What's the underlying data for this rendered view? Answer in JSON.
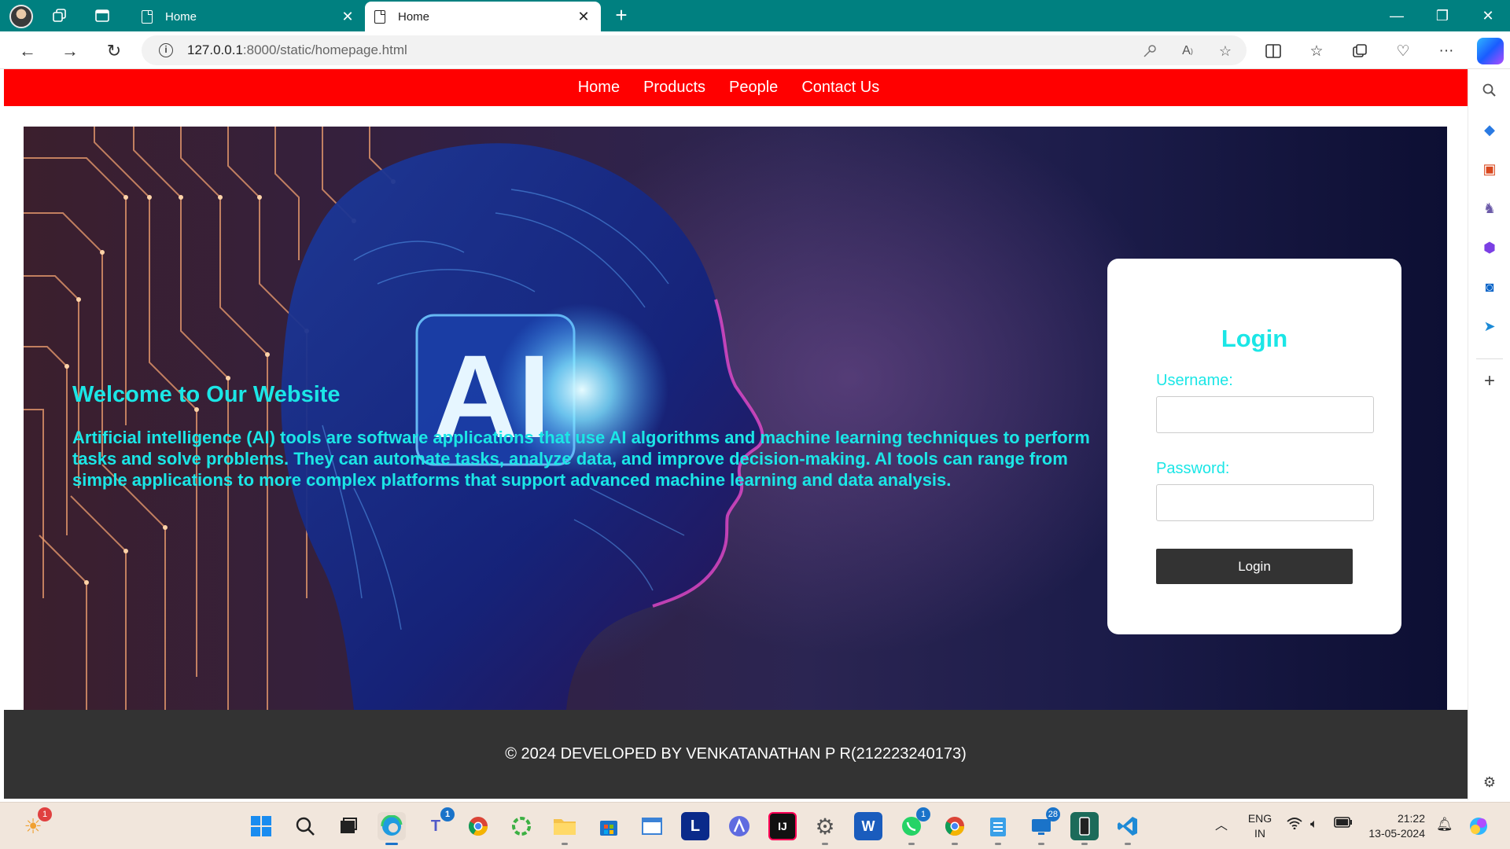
{
  "browser": {
    "tabs": [
      {
        "title": "Home",
        "active": false
      },
      {
        "title": "Home",
        "active": true
      }
    ],
    "address": {
      "host": "127.0.0.1",
      "rest": ":8000/static/homepage.html"
    },
    "window_controls": {
      "minimize": "—",
      "restore": "❐",
      "close": "✕"
    }
  },
  "site": {
    "nav": [
      "Home",
      "Products",
      "People",
      "Contact Us"
    ],
    "hero_badge": "AI",
    "welcome_title": "Welcome to Our Website",
    "intro": "Artificial intelligence (AI) tools are software applications that use AI algorithms and machine learning techniques to perform tasks and solve problems. They can automate tasks, analyze data, and improve decision-making. AI tools can range from simple applications to more complex platforms that support advanced machine learning and data analysis.",
    "login": {
      "title": "Login",
      "username_label": "Username:",
      "username_value": "",
      "password_label": "Password:",
      "password_value": "",
      "button": "Login"
    },
    "footer": "© 2024 DEVELOPED BY VENKATANATHAN P R(212223240173)",
    "colors": {
      "nav_bg": "#ff0000",
      "accent": "#1be6e6",
      "footer_bg": "#333333"
    }
  },
  "taskbar": {
    "weather_badge": "1",
    "teams_badge": "1",
    "whatsapp_badge": "1",
    "store_badge": "28",
    "lang_top": "ENG",
    "lang_bottom": "IN",
    "time": "21:22",
    "date": "13-05-2024",
    "app_letters": {
      "L": "L",
      "IJ": "IJ",
      "W": "W"
    }
  }
}
